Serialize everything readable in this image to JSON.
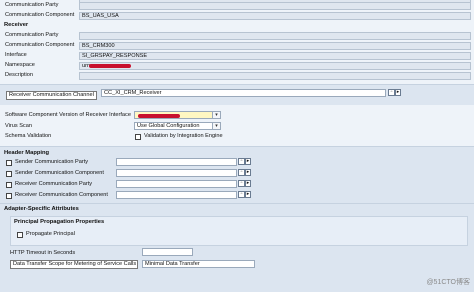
{
  "sender_top": {
    "communication_party_label": "Communication Party",
    "communication_component_label": "Communication Component",
    "communication_component_value": "BS_UAS_USA"
  },
  "receiver": {
    "section_title": "Receiver",
    "communication_party_label": "Communication Party",
    "communication_component_label": "Communication Component",
    "communication_component_value": "BS_CRM300",
    "interface_label": "Interface",
    "interface_value": "SI_GRSPAY_RESPONSE",
    "namespace_label": "Namespace",
    "namespace_value": "urn",
    "description_label": "Description"
  },
  "receiver_channel": {
    "label": "Receiver Communication Channel",
    "value": "CC_XI_CRM_Receiver"
  },
  "settings": {
    "software_component_label": "Software Component Version of Receiver Interface",
    "virus_scan_label": "Virus Scan",
    "virus_scan_value": "Use Global Configuration",
    "schema_validation_label": "Schema Validation",
    "schema_validation_option": "Validation by Integration Engine"
  },
  "header_mapping": {
    "section_title": "Header Mapping",
    "items": [
      {
        "label": "Sender Communication Party"
      },
      {
        "label": "Sender Communication Component"
      },
      {
        "label": "Receiver Communication Party"
      },
      {
        "label": "Receiver Communication Component"
      }
    ]
  },
  "adapter": {
    "section_title": "Adapter-Specific Attributes",
    "principal_title": "Principal Propagation Properties",
    "propagate_label": "Propagate Principal",
    "http_timeout_label": "HTTP Timeout in Seconds",
    "data_transfer_label": "Data Transfer Scope for Metering of Service Calls",
    "data_transfer_value": "Minimal Data Transfer"
  },
  "watermark": "@51CTO博客",
  "colors": {
    "background": "#eef3f9",
    "readonly_field": "#dfe6ef",
    "redaction": "#c8102e",
    "highlight_input": "#fff7c2"
  }
}
